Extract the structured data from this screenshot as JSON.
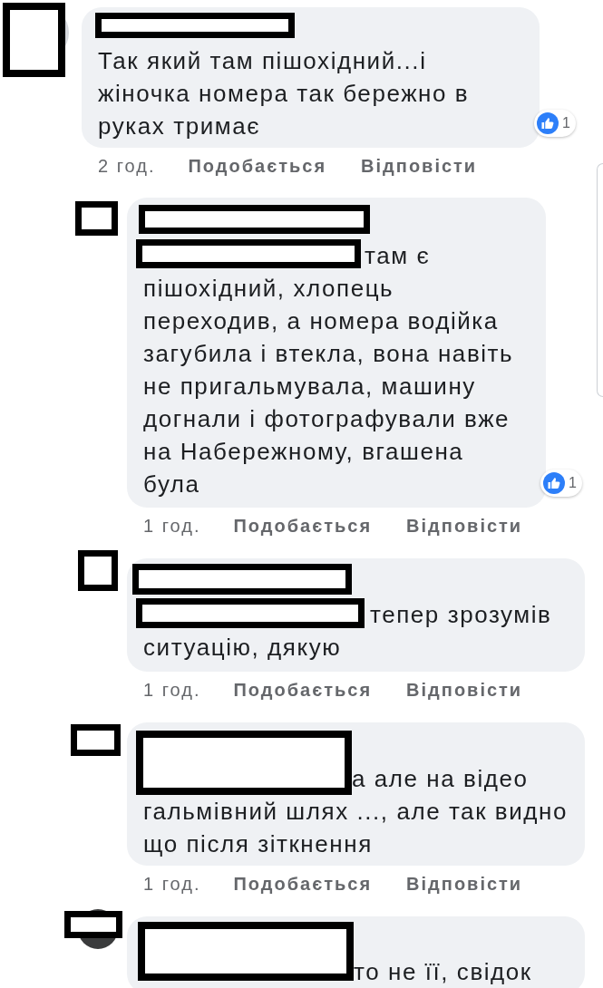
{
  "comments": [
    {
      "avatar_redacted": true,
      "author_redacted": true,
      "text": "Так який там пішохідний...і жіночка номера так бережно в руках тримає",
      "reactions": "1",
      "time": "2 год.",
      "like": "Подобається",
      "reply": "Відповісти",
      "children": [
        {
          "avatar_redacted": true,
          "author_redacted": true,
          "mention_redacted": true,
          "text": "там є пішохідний, хлопець переходив, а номера водійка загубила і втекла, вона навіть не пригальмувала, машину догнали і фотографували вже на Набережному, вгашена була",
          "reactions": "1",
          "time": "1 год.",
          "like": "Подобається",
          "reply": "Відповісти"
        },
        {
          "avatar_redacted": true,
          "author_redacted": true,
          "mention_redacted": true,
          "text": "тепер зрозумів ситуацію, дякую",
          "time": "1 год.",
          "like": "Подобається",
          "reply": "Відповісти"
        },
        {
          "avatar_redacted": true,
          "author_redacted": true,
          "mention_redacted": true,
          "text": "а але на відео гальмівний шлях ..., але так видно що після зіткнення",
          "time": "1 год.",
          "like": "Подобається",
          "reply": "Відповісти"
        },
        {
          "avatar_redacted": true,
          "author_redacted": true,
          "mention_redacted": true,
          "text": "то не її, свідок"
        }
      ]
    }
  ]
}
